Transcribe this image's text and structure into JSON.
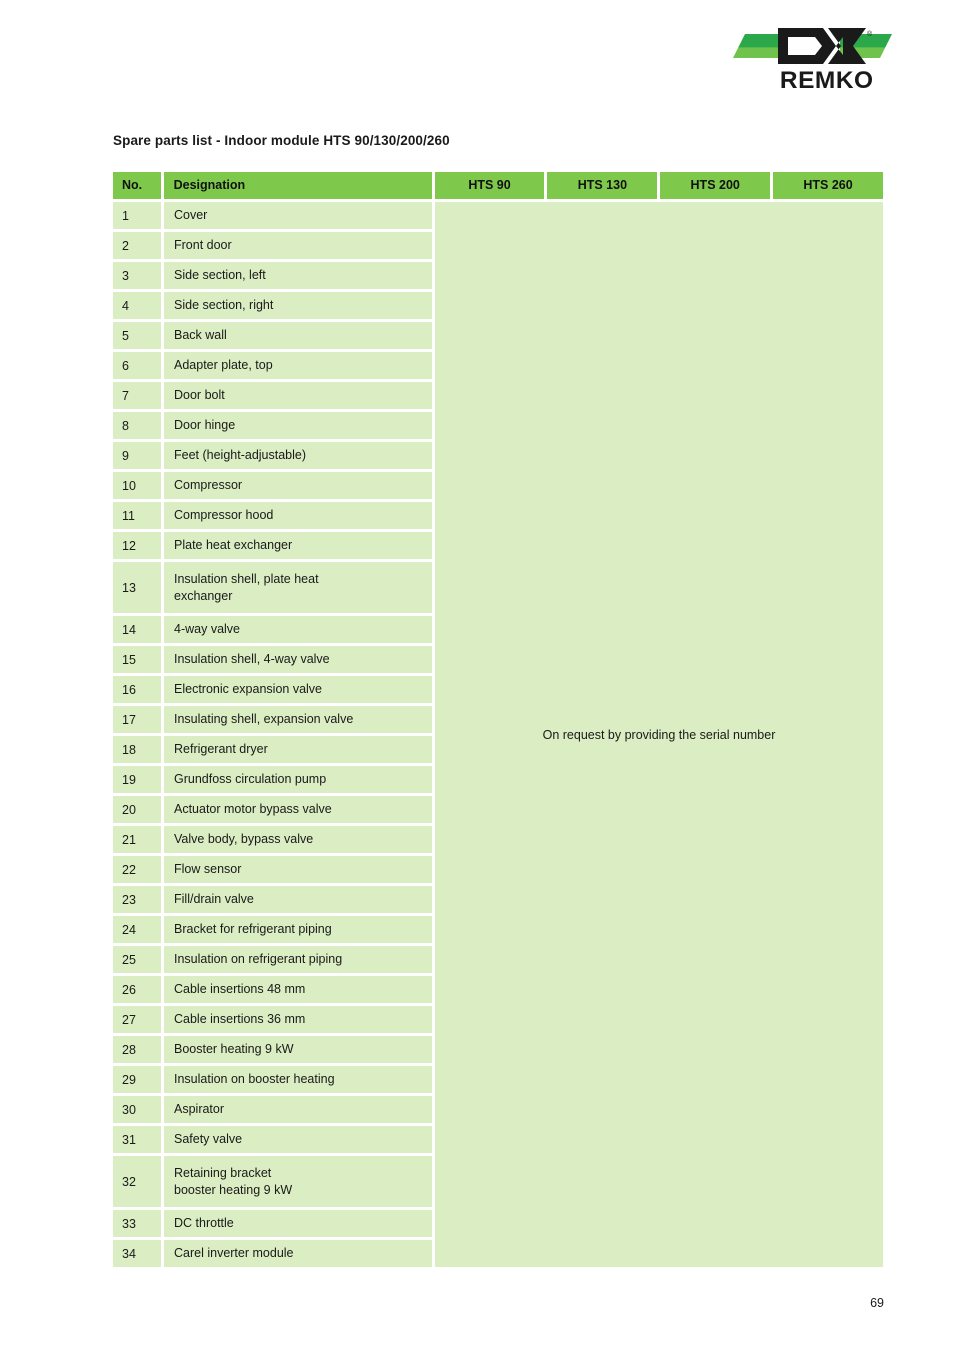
{
  "logo": {
    "brand_name": "REMKO",
    "registered_mark": "®",
    "green_dark": "#2BA84A",
    "green_light": "#6FC24B",
    "mark_color": "#1A1A1A"
  },
  "document": {
    "title": "Spare parts list - Indoor module HTS 90/130/200/260",
    "page_number": "69"
  },
  "table": {
    "header": {
      "no": "No.",
      "designation": "Designation",
      "models": [
        "HTS 90",
        "HTS 130",
        "HTS 200",
        "HTS 260"
      ]
    },
    "header_bg": "#7EC94B",
    "cell_bg": "#DBEDC2",
    "merged_note": "On request by providing the serial number",
    "rows": [
      {
        "no": "1",
        "designation": "Cover"
      },
      {
        "no": "2",
        "designation": "Front door"
      },
      {
        "no": "3",
        "designation": "Side section, left"
      },
      {
        "no": "4",
        "designation": "Side section, right"
      },
      {
        "no": "5",
        "designation": "Back wall"
      },
      {
        "no": "6",
        "designation": "Adapter plate, top"
      },
      {
        "no": "7",
        "designation": "Door bolt"
      },
      {
        "no": "8",
        "designation": "Door hinge"
      },
      {
        "no": "9",
        "designation": "Feet (height-adjustable)"
      },
      {
        "no": "10",
        "designation": "Compressor"
      },
      {
        "no": "11",
        "designation": "Compressor hood"
      },
      {
        "no": "12",
        "designation": "Plate heat exchanger"
      },
      {
        "no": "13",
        "designation": "Insulation shell, plate heat",
        "designation_line2": "exchanger"
      },
      {
        "no": "14",
        "designation": "4-way valve"
      },
      {
        "no": "15",
        "designation": "Insulation shell, 4-way valve"
      },
      {
        "no": "16",
        "designation": "Electronic expansion valve"
      },
      {
        "no": "17",
        "designation": "Insulating shell, expansion valve"
      },
      {
        "no": "18",
        "designation": "Refrigerant dryer"
      },
      {
        "no": "19",
        "designation": "Grundfoss circulation pump"
      },
      {
        "no": "20",
        "designation": "Actuator motor bypass valve"
      },
      {
        "no": "21",
        "designation": "Valve body, bypass valve"
      },
      {
        "no": "22",
        "designation": "Flow sensor"
      },
      {
        "no": "23",
        "designation": "Fill/drain valve"
      },
      {
        "no": "24",
        "designation": "Bracket for refrigerant piping"
      },
      {
        "no": "25",
        "designation": "Insulation on refrigerant piping"
      },
      {
        "no": "26",
        "designation": "Cable insertions 48 mm"
      },
      {
        "no": "27",
        "designation": "Cable insertions 36 mm"
      },
      {
        "no": "28",
        "designation": "Booster heating 9 kW"
      },
      {
        "no": "29",
        "designation": "Insulation on booster heating"
      },
      {
        "no": "30",
        "designation": "Aspirator"
      },
      {
        "no": "31",
        "designation": "Safety valve"
      },
      {
        "no": "32",
        "designation": "Retaining bracket",
        "designation_line2": "booster heating 9 kW"
      },
      {
        "no": "33",
        "designation": "DC throttle"
      },
      {
        "no": "34",
        "designation": "Carel inverter module"
      }
    ]
  }
}
